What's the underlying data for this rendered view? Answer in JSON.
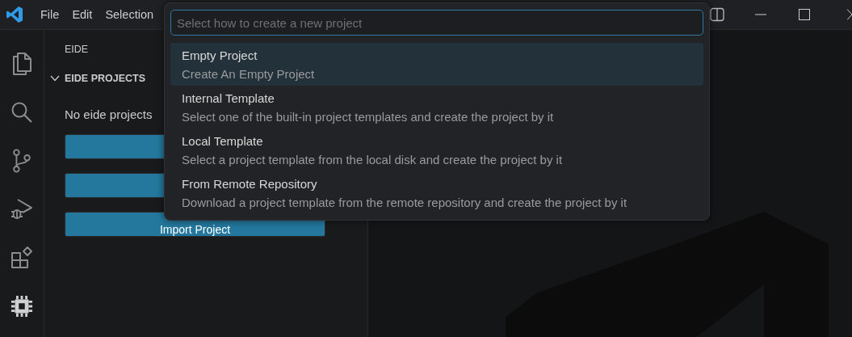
{
  "menu": [
    {
      "label": "File"
    },
    {
      "label": "Edit"
    },
    {
      "label": "Selection"
    }
  ],
  "activity_bar": [
    {
      "kind": "files",
      "selected": false
    },
    {
      "kind": "search",
      "selected": false
    },
    {
      "kind": "branch",
      "selected": false
    },
    {
      "kind": "debug",
      "selected": false
    },
    {
      "kind": "extensions",
      "selected": false
    },
    {
      "kind": "chip",
      "selected": true
    }
  ],
  "sidebar": {
    "title": "EIDE",
    "section": {
      "title": "EIDE PROJECTS",
      "expanded": true
    },
    "message": "No eide projects",
    "buttons": [
      {
        "kind": "covered"
      },
      {
        "kind": "covered"
      },
      {
        "kind": "labeled",
        "label": "Import Project"
      }
    ]
  },
  "quick_pick": {
    "placeholder": "Select how to create a new project",
    "items": [
      {
        "label": "Empty Project",
        "description": "Create An Empty Project",
        "selected": true
      },
      {
        "label": "Internal Template",
        "description": "Select one of the built-in project templates and create the project by it",
        "selected": false
      },
      {
        "label": "Local Template",
        "description": "Select a project template from the local disk and create the project by it",
        "selected": false
      },
      {
        "label": "From Remote Repository",
        "description": "Download a project template from the remote repository and create the project by it",
        "selected": false
      }
    ]
  }
}
